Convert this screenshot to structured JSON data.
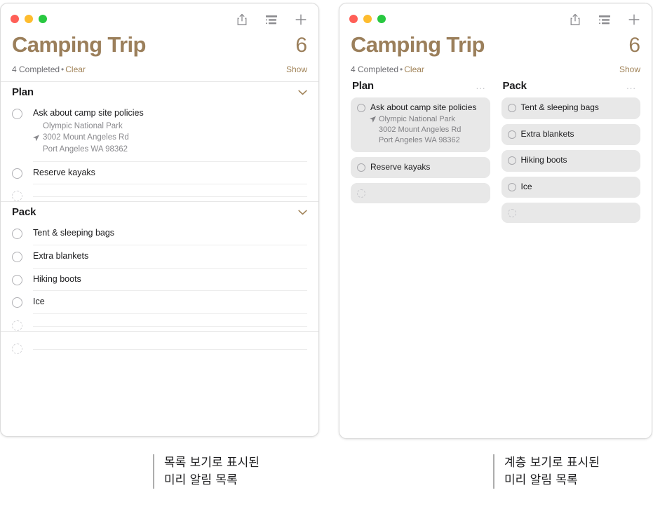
{
  "accent_color": "#9b7f5b",
  "window_list": {
    "traffic_lights": [
      "close",
      "minimize",
      "zoom"
    ],
    "toolbar": {
      "share_label": "Share",
      "view_label": "View Options",
      "add_label": "Add Reminder"
    },
    "header": {
      "title": "Camping Trip",
      "count": "6",
      "completed": "4 Completed",
      "separator": "•",
      "clear": "Clear",
      "show": "Show"
    },
    "groups": [
      {
        "name": "Plan",
        "collapse_icon": "chevron-down-icon",
        "items": [
          {
            "title": "Ask about camp site policies",
            "sub": [
              "Olympic National Park",
              "3002 Mount Angeles Rd",
              "Port Angeles WA 98362"
            ],
            "location": true,
            "empty": false
          },
          {
            "title": "Reserve kayaks",
            "sub": [],
            "location": false,
            "empty": false
          },
          {
            "title": "",
            "sub": [],
            "location": false,
            "empty": true
          }
        ]
      },
      {
        "name": "Pack",
        "collapse_icon": "chevron-down-icon",
        "items": [
          {
            "title": "Tent & sleeping bags",
            "sub": [],
            "location": false,
            "empty": false
          },
          {
            "title": "Extra blankets",
            "sub": [],
            "location": false,
            "empty": false
          },
          {
            "title": "Hiking boots",
            "sub": [],
            "location": false,
            "empty": false
          },
          {
            "title": "Ice",
            "sub": [],
            "location": false,
            "empty": false
          },
          {
            "title": "",
            "sub": [],
            "location": false,
            "empty": true
          }
        ]
      }
    ],
    "trailing_empty_row": {
      "title": "",
      "empty": true
    }
  },
  "window_column": {
    "traffic_lights": [
      "close",
      "minimize",
      "zoom"
    ],
    "toolbar": {
      "share_label": "Share",
      "view_label": "View Options",
      "add_label": "Add Reminder"
    },
    "header": {
      "title": "Camping Trip",
      "count": "6",
      "completed": "4 Completed",
      "separator": "•",
      "clear": "Clear",
      "show": "Show"
    },
    "columns": [
      {
        "name": "Plan",
        "menu": "...",
        "cards": [
          {
            "title": "Ask about camp site policies",
            "sub": [
              "Olympic National Park",
              "3002 Mount Angeles Rd",
              "Port Angeles WA 98362"
            ],
            "location": true,
            "empty": false
          },
          {
            "title": "Reserve kayaks",
            "sub": [],
            "location": false,
            "empty": false
          },
          {
            "title": "",
            "sub": [],
            "location": false,
            "empty": true
          }
        ]
      },
      {
        "name": "Pack",
        "menu": "...",
        "cards": [
          {
            "title": "Tent & sleeping bags",
            "sub": [],
            "location": false,
            "empty": false
          },
          {
            "title": "Extra blankets",
            "sub": [],
            "location": false,
            "empty": false
          },
          {
            "title": "Hiking boots",
            "sub": [],
            "location": false,
            "empty": false
          },
          {
            "title": "Ice",
            "sub": [],
            "location": false,
            "empty": false
          },
          {
            "title": "",
            "sub": [],
            "location": false,
            "empty": true
          }
        ]
      }
    ]
  },
  "captions": {
    "list_view": "목록 보기로 표시된\n미리 알림 목록",
    "column_view": "계층 보기로 표시된\n미리 알림 목록"
  }
}
